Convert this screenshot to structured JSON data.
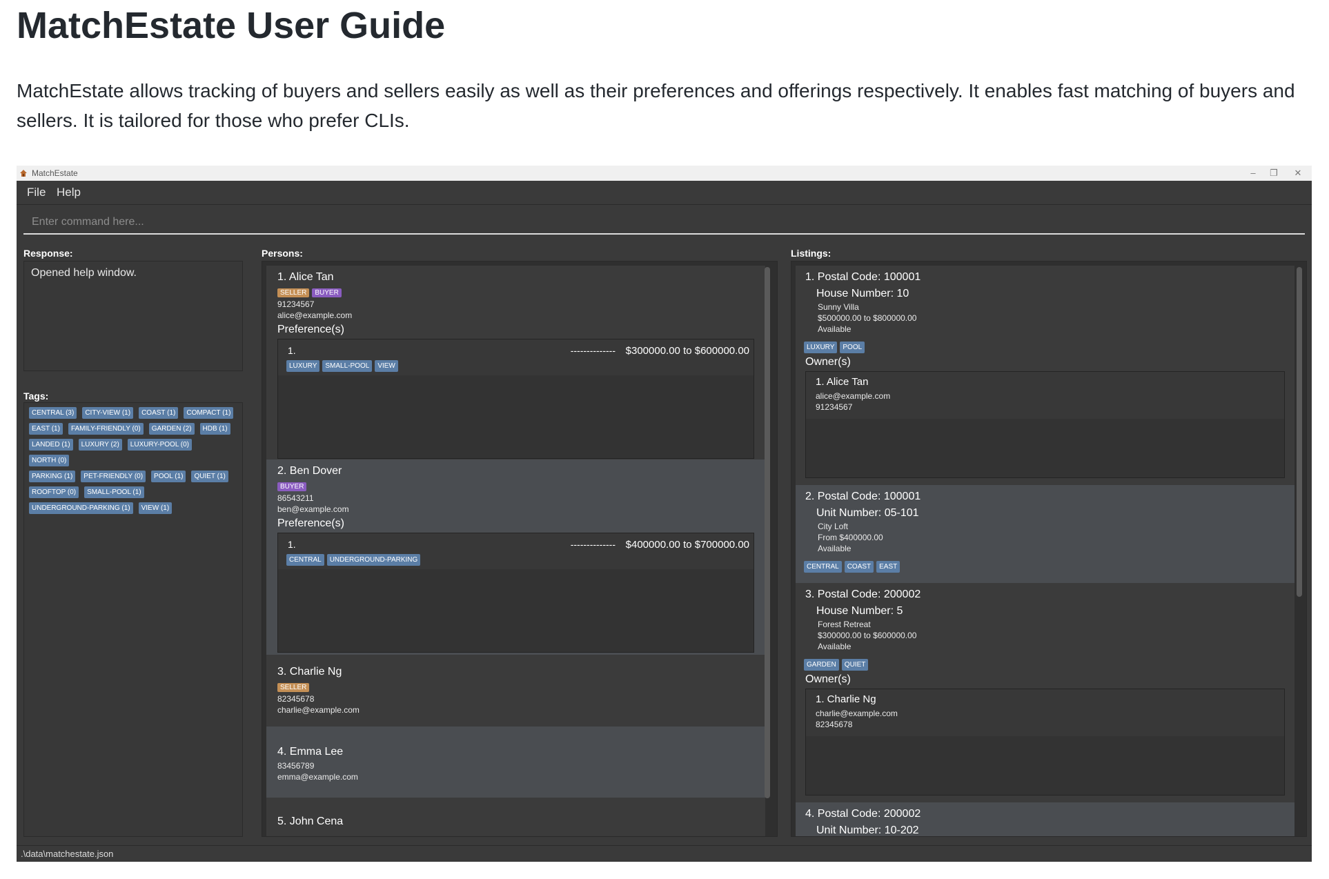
{
  "doc": {
    "title": "MatchEstate User Guide",
    "intro": "MatchEstate allows tracking of buyers and sellers easily as well as their preferences and offerings respectively. It enables fast matching of buyers and sellers. It is tailored for those who prefer CLIs."
  },
  "window": {
    "title": "MatchEstate",
    "minimize": "–",
    "restore": "❐",
    "close": "✕"
  },
  "menu": {
    "file": "File",
    "help": "Help"
  },
  "command": {
    "placeholder": "Enter command here..."
  },
  "labels": {
    "response": "Response:",
    "tags": "Tags:",
    "persons": "Persons:",
    "listings": "Listings:"
  },
  "response": {
    "text": "Opened help window."
  },
  "tags": [
    "CENTRAL (3)",
    "CITY-VIEW (1)",
    "COAST (1)",
    "COMPACT (1)",
    "EAST (1)",
    "FAMILY-FRIENDLY (0)",
    "GARDEN (2)",
    "HDB (1)",
    "LANDED (1)",
    "LUXURY (2)",
    "LUXURY-POOL (0)",
    "NORTH (0)",
    "PARKING (1)",
    "PET-FRIENDLY (0)",
    "POOL (1)",
    "QUIET (1)",
    "ROOFTOP (0)",
    "SMALL-POOL (1)",
    "UNDERGROUND-PARKING (1)",
    "VIEW (1)"
  ],
  "persons": [
    {
      "name": "1. Alice Tan",
      "seller": "SELLER",
      "buyer": "BUYER",
      "phone": "91234567",
      "email": "alice@example.com",
      "pref_heading": "Preference(s)",
      "pref": {
        "num": "1.",
        "dashes": "--------------",
        "range": "$300000.00 to $600000.00",
        "tags": [
          "LUXURY",
          "SMALL-POOL",
          "VIEW"
        ]
      }
    },
    {
      "name": "2. Ben Dover",
      "buyer": "BUYER",
      "phone": "86543211",
      "email": "ben@example.com",
      "pref_heading": "Preference(s)",
      "pref": {
        "num": "1.",
        "dashes": "--------------",
        "range": "$400000.00 to $700000.00",
        "tags": [
          "CENTRAL",
          "UNDERGROUND-PARKING"
        ]
      }
    },
    {
      "name": "3. Charlie Ng",
      "seller": "SELLER",
      "phone": "82345678",
      "email": "charlie@example.com"
    },
    {
      "name": "4. Emma Lee",
      "phone": "83456789",
      "email": "emma@example.com"
    },
    {
      "name": "5. John Cena"
    }
  ],
  "listings": [
    {
      "postal": "1. Postal Code: 100001",
      "unit": "House Number: 10",
      "name": "Sunny Villa",
      "price": "$500000.00 to $800000.00",
      "status": "Available",
      "tags": [
        "LUXURY",
        "POOL"
      ],
      "owner_heading": "Owner(s)",
      "owner": {
        "name": "1. Alice Tan",
        "email": "alice@example.com",
        "phone": "91234567"
      }
    },
    {
      "postal": "2. Postal Code: 100001",
      "unit": "Unit Number: 05-101",
      "name": "City Loft",
      "price": "From $400000.00",
      "status": "Available",
      "tags": [
        "CENTRAL",
        "COAST",
        "EAST"
      ]
    },
    {
      "postal": "3. Postal Code: 200002",
      "unit": "House Number: 5",
      "name": "Forest Retreat",
      "price": "$300000.00 to $600000.00",
      "status": "Available",
      "tags": [
        "GARDEN",
        "QUIET"
      ],
      "owner_heading": "Owner(s)",
      "owner": {
        "name": "1. Charlie Ng",
        "email": "charlie@example.com",
        "phone": "82345678"
      }
    },
    {
      "postal": "4. Postal Code: 200002",
      "unit": "Unit Number: 10-202"
    }
  ],
  "status": {
    "path": ".\\data\\matchestate.json"
  },
  "colors": {
    "tag": "#5b7ea6",
    "seller": "#c48f55",
    "buyer": "#8a5cc0",
    "background": "#3a3a3a"
  }
}
